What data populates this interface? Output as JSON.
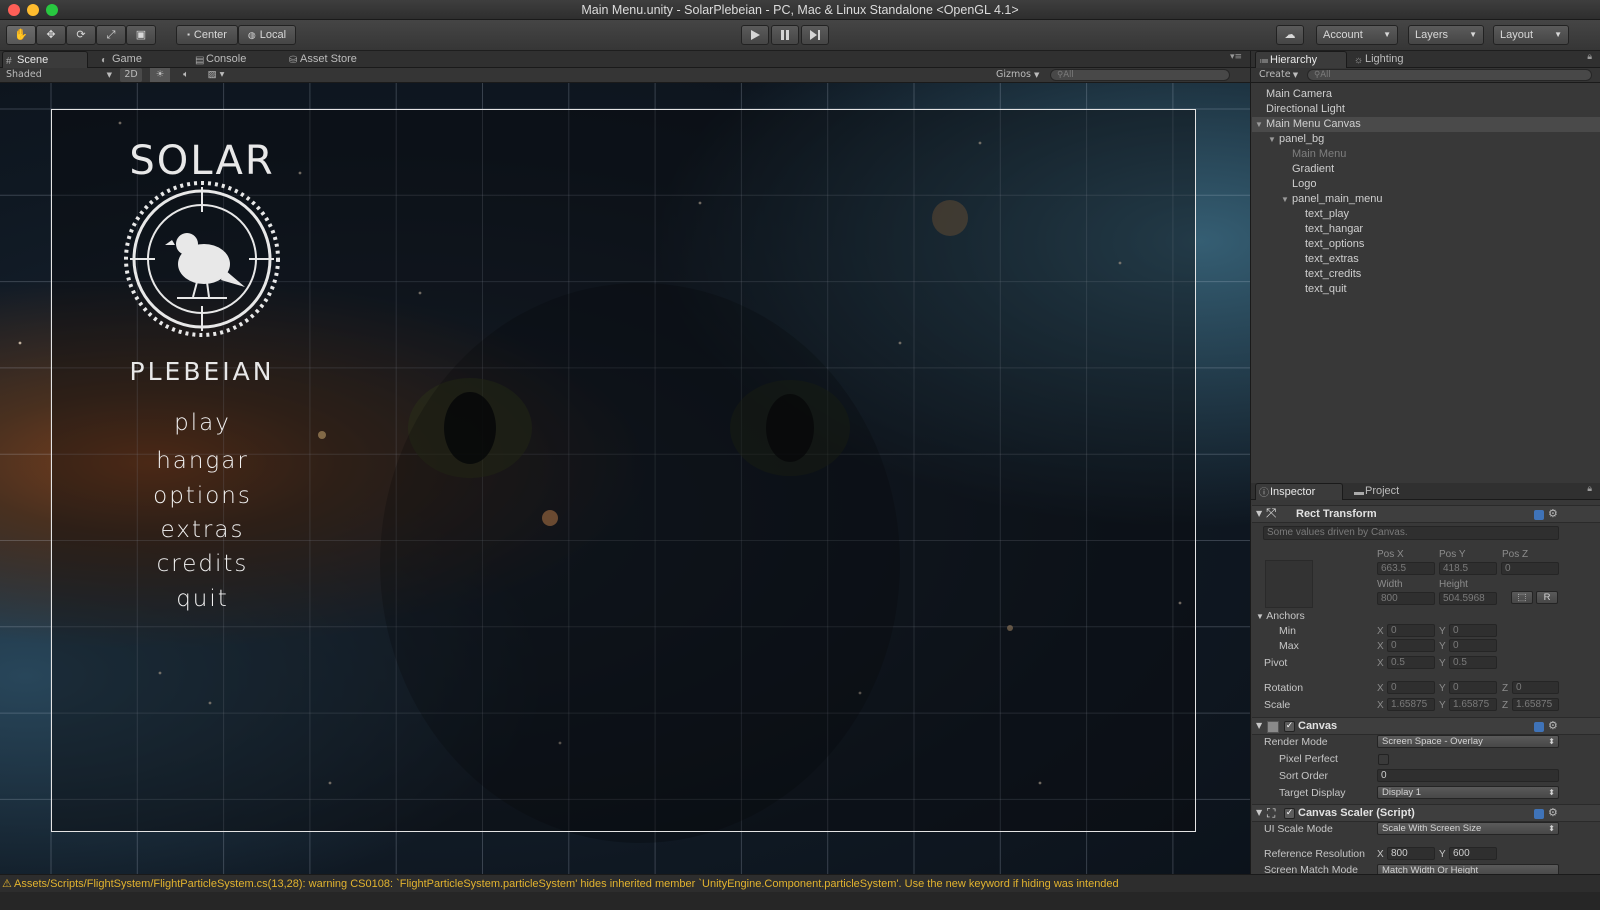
{
  "window": {
    "title": "Main Menu.unity - SolarPlebeian - PC, Mac & Linux Standalone <OpenGL 4.1>",
    "traffic_light_colors": [
      "#ff5f57",
      "#febc2e",
      "#28c840"
    ]
  },
  "toolbar": {
    "tools": [
      "hand-tool",
      "move-tool",
      "rotate-tool",
      "scale-tool",
      "rect-tool"
    ],
    "pivot_label": "Center",
    "space_label": "Local",
    "play_icon": "play-icon",
    "pause_icon": "pause-icon",
    "step_icon": "step-icon",
    "cloud_icon": "cloud-icon",
    "account_label": "Account",
    "layers_label": "Layers",
    "layout_label": "Layout"
  },
  "scene_tabs": [
    {
      "label": "Scene",
      "icon": "scene-icon",
      "selected": true
    },
    {
      "label": "Game",
      "icon": "game-icon",
      "selected": false
    },
    {
      "label": "Console",
      "icon": "console-icon",
      "selected": false
    },
    {
      "label": "Asset Store",
      "icon": "asset-store-icon",
      "selected": false
    }
  ],
  "scene_bar": {
    "draw_mode": "Shaded",
    "mode_2d": "2D",
    "gizmos_label": "Gizmos",
    "search_placeholder": "All"
  },
  "game_ui": {
    "logo_top": "SOLAR",
    "logo_bottom": "PLEBEIAN",
    "menu": [
      "play",
      "hangar",
      "options",
      "extras",
      "credits",
      "quit"
    ]
  },
  "hierarchy": {
    "tabs": [
      {
        "label": "Hierarchy",
        "selected": true
      },
      {
        "label": "Lighting",
        "selected": false
      }
    ],
    "create_label": "Create",
    "search_placeholder": "All",
    "items": [
      {
        "label": "Main Camera",
        "depth": 0,
        "selected": false,
        "dim": false,
        "expanded": null
      },
      {
        "label": "Directional Light",
        "depth": 0,
        "selected": false,
        "dim": false,
        "expanded": null
      },
      {
        "label": "Main Menu Canvas",
        "depth": 0,
        "selected": true,
        "dim": false,
        "expanded": true
      },
      {
        "label": "panel_bg",
        "depth": 1,
        "selected": false,
        "dim": false,
        "expanded": true
      },
      {
        "label": "Main Menu",
        "depth": 2,
        "selected": false,
        "dim": true,
        "expanded": null
      },
      {
        "label": "Gradient",
        "depth": 2,
        "selected": false,
        "dim": false,
        "expanded": null
      },
      {
        "label": "Logo",
        "depth": 2,
        "selected": false,
        "dim": false,
        "expanded": null
      },
      {
        "label": "panel_main_menu",
        "depth": 2,
        "selected": false,
        "dim": false,
        "expanded": true
      },
      {
        "label": "text_play",
        "depth": 3,
        "selected": false,
        "dim": false,
        "expanded": null
      },
      {
        "label": "text_hangar",
        "depth": 3,
        "selected": false,
        "dim": false,
        "expanded": null
      },
      {
        "label": "text_options",
        "depth": 3,
        "selected": false,
        "dim": false,
        "expanded": null
      },
      {
        "label": "text_extras",
        "depth": 3,
        "selected": false,
        "dim": false,
        "expanded": null
      },
      {
        "label": "text_credits",
        "depth": 3,
        "selected": false,
        "dim": false,
        "expanded": null
      },
      {
        "label": "text_quit",
        "depth": 3,
        "selected": false,
        "dim": false,
        "expanded": null
      }
    ]
  },
  "inspector": {
    "tabs": [
      {
        "label": "Inspector",
        "selected": true
      },
      {
        "label": "Project",
        "selected": false
      }
    ],
    "rect_transform": {
      "title": "Rect Transform",
      "note": "Some values driven by Canvas.",
      "pos_x_label": "Pos X",
      "pos_y_label": "Pos Y",
      "pos_z_label": "Pos Z",
      "pos_x": "663.5",
      "pos_y": "418.5",
      "pos_z": "0",
      "width_label": "Width",
      "height_label": "Height",
      "width": "800",
      "height": "504.5968",
      "r_label": "R",
      "anchors_label": "Anchors",
      "min_label": "Min",
      "max_label": "Max",
      "min_x": "0",
      "min_y": "0",
      "max_x": "0",
      "max_y": "0",
      "pivot_label": "Pivot",
      "pivot_x": "0.5",
      "pivot_y": "0.5",
      "rotation_label": "Rotation",
      "rot_x": "0",
      "rot_y": "0",
      "rot_z": "0",
      "scale_label": "Scale",
      "scale_x": "1.65875",
      "scale_y": "1.65875",
      "scale_z": "1.65875",
      "x": "X",
      "y": "Y",
      "z": "Z"
    },
    "canvas": {
      "title": "Canvas",
      "render_mode_label": "Render Mode",
      "render_mode": "Screen Space - Overlay",
      "pixel_perfect_label": "Pixel Perfect",
      "sort_order_label": "Sort Order",
      "sort_order": "0",
      "target_display_label": "Target Display",
      "target_display": "Display 1"
    },
    "canvas_scaler": {
      "title": "Canvas Scaler (Script)",
      "ui_scale_mode_label": "UI Scale Mode",
      "ui_scale_mode": "Scale With Screen Size",
      "ref_res_label": "Reference Resolution",
      "ref_x": "800",
      "ref_y": "600",
      "screen_match_label": "Screen Match Mode",
      "screen_match": "Match Width Or Height"
    }
  },
  "status": {
    "message": "Assets/Scripts/FlightSystem/FlightParticleSystem.cs(13,28): warning CS0108: `FlightParticleSystem.particleSystem' hides inherited member `UnityEngine.Component.particleSystem'. Use the new keyword if hiding was intended",
    "color": "#e2b32f"
  }
}
